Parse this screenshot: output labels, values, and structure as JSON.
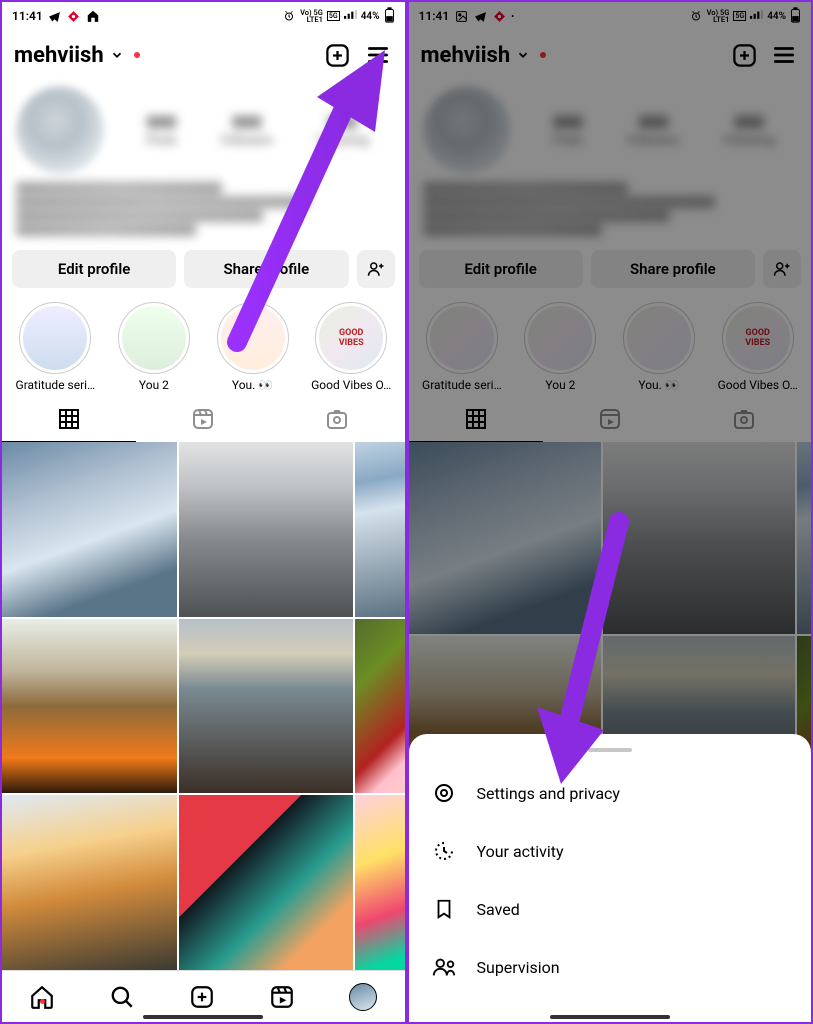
{
  "status": {
    "time": "11:41",
    "network_text": "Vo) 5G",
    "signal_text": "LTE1",
    "battery": "44%"
  },
  "header": {
    "username": "mehviish"
  },
  "buttons": {
    "edit": "Edit profile",
    "share": "Share profile"
  },
  "highlights": [
    {
      "label": "Gratitude seri…"
    },
    {
      "label": "You 2"
    },
    {
      "label": "You. 👀"
    },
    {
      "label": "Good Vibes O…"
    }
  ],
  "sheet": {
    "items": [
      {
        "label": "Settings and privacy",
        "icon": "gear"
      },
      {
        "label": "Your activity",
        "icon": "activity"
      },
      {
        "label": "Saved",
        "icon": "bookmark"
      },
      {
        "label": "Supervision",
        "icon": "people"
      }
    ]
  }
}
